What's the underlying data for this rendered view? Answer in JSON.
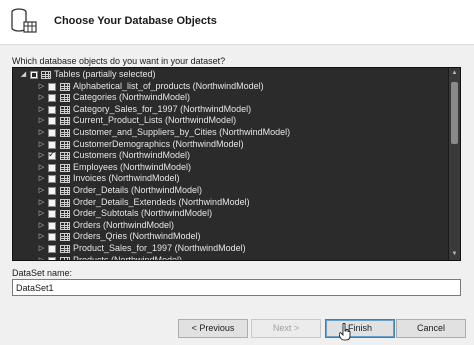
{
  "header": {
    "title": "Choose Your Database Objects",
    "icon": "database-wizard-icon"
  },
  "prompt": "Which database objects do you want in your dataset?",
  "tree": {
    "root": {
      "label": "Tables (partially selected)",
      "state": "partial"
    },
    "items": [
      {
        "label": "Alphabetical_list_of_products (NorthwindModel)",
        "checked": false
      },
      {
        "label": "Categories (NorthwindModel)",
        "checked": false
      },
      {
        "label": "Category_Sales_for_1997 (NorthwindModel)",
        "checked": false
      },
      {
        "label": "Current_Product_Lists (NorthwindModel)",
        "checked": false
      },
      {
        "label": "Customer_and_Suppliers_by_Cities (NorthwindModel)",
        "checked": false
      },
      {
        "label": "CustomerDemographics (NorthwindModel)",
        "checked": false
      },
      {
        "label": "Customers (NorthwindModel)",
        "checked": true
      },
      {
        "label": "Employees (NorthwindModel)",
        "checked": false
      },
      {
        "label": "Invoices (NorthwindModel)",
        "checked": false
      },
      {
        "label": "Order_Details (NorthwindModel)",
        "checked": false
      },
      {
        "label": "Order_Details_Extendeds (NorthwindModel)",
        "checked": false
      },
      {
        "label": "Order_Subtotals (NorthwindModel)",
        "checked": false
      },
      {
        "label": "Orders (NorthwindModel)",
        "checked": false
      },
      {
        "label": "Orders_Qries (NorthwindModel)",
        "checked": false
      },
      {
        "label": "Product_Sales_for_1997 (NorthwindModel)",
        "checked": false
      },
      {
        "label": "Products (NorthwindModel)",
        "checked": false
      }
    ]
  },
  "dataset": {
    "label": "DataSet name:",
    "value": "DataSet1"
  },
  "buttons": {
    "previous": "< Previous",
    "next": "Next >",
    "finish": "Finish",
    "cancel": "Cancel"
  },
  "colors": {
    "tree_background": "#2b2b2b",
    "primary_border": "#3c7fb1"
  }
}
